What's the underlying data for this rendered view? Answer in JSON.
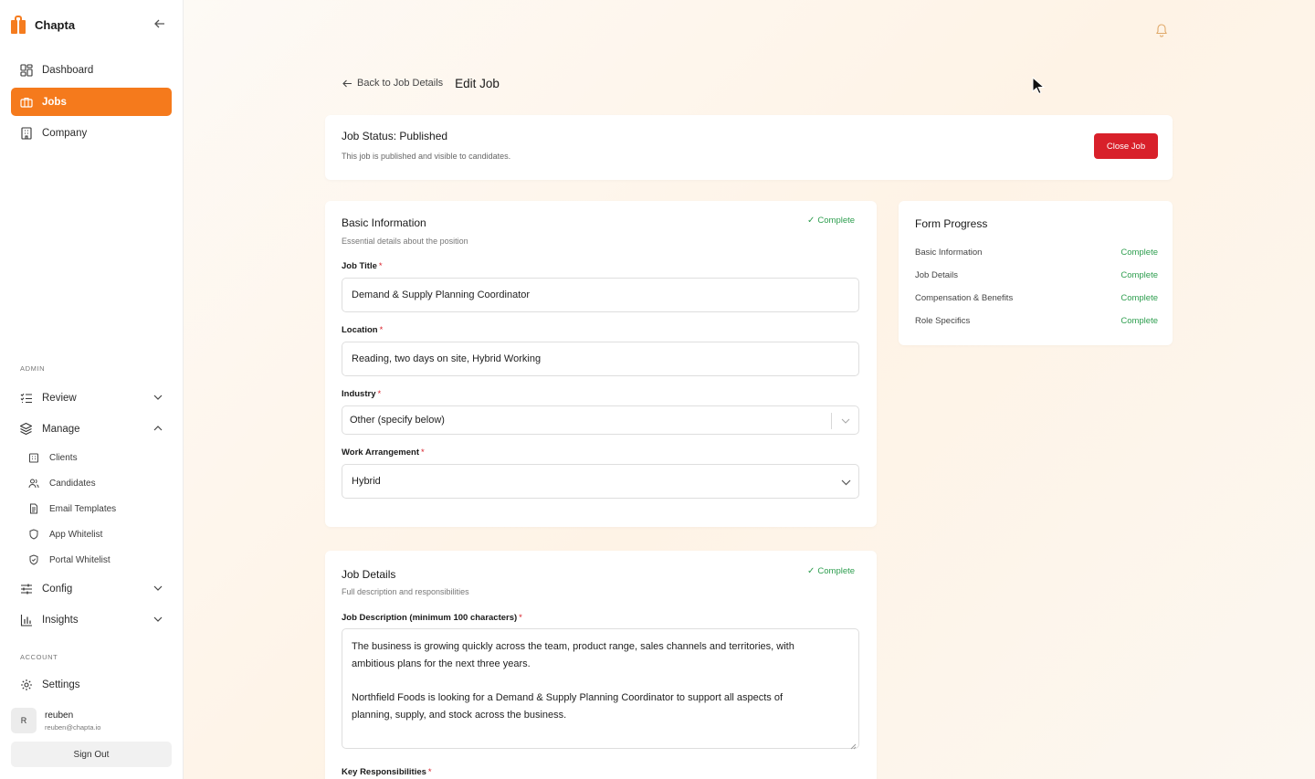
{
  "brand": {
    "name": "Chapta"
  },
  "nav": {
    "primary": [
      {
        "label": "Dashboard",
        "icon": "dashboard-icon"
      },
      {
        "label": "Jobs",
        "icon": "briefcase-icon",
        "active": true
      },
      {
        "label": "Company",
        "icon": "building-icon"
      }
    ],
    "admin_label": "ADMIN",
    "review": {
      "label": "Review"
    },
    "manage": {
      "label": "Manage"
    },
    "manage_items": [
      {
        "label": "Clients",
        "icon": "clients-icon"
      },
      {
        "label": "Candidates",
        "icon": "candidates-icon"
      },
      {
        "label": "Email Templates",
        "icon": "document-icon"
      },
      {
        "label": "App Whitelist",
        "icon": "shield-icon"
      },
      {
        "label": "Portal Whitelist",
        "icon": "shield-check-icon"
      }
    ],
    "config": {
      "label": "Config"
    },
    "insights": {
      "label": "Insights"
    },
    "account_label": "ACCOUNT",
    "settings": {
      "label": "Settings"
    }
  },
  "user": {
    "initial": "R",
    "name": "reuben",
    "email": "reuben@chapta.io"
  },
  "signout_label": "Sign Out",
  "header": {
    "back_label": "Back to Job Details",
    "title": "Edit Job"
  },
  "status": {
    "title": "Job Status: Published",
    "subtitle": "This job is published and visible to candidates.",
    "close_label": "Close Job"
  },
  "basic": {
    "title": "Basic Information",
    "subtitle": "Essential details about the position",
    "badge": "Complete",
    "job_title_label": "Job Title",
    "job_title_value": "Demand & Supply Planning Coordinator",
    "location_label": "Location",
    "location_value": "Reading, two days on site, Hybrid Working",
    "industry_label": "Industry",
    "industry_value": "Other (specify below)",
    "work_label": "Work Arrangement",
    "work_value": "Hybrid",
    "required_mark": "*"
  },
  "details": {
    "title": "Job Details",
    "subtitle": "Full description and responsibilities",
    "badge": "Complete",
    "desc_label": "Job Description (minimum 100 characters)",
    "desc_p1_l1": "The business is growing quickly across the team, product range, sales channels and territories, with",
    "desc_p1_l2": "ambitious plans for the next three years.",
    "desc_p2_l1": "Northfield Foods is looking for a Demand & Supply Planning Coordinator to support all aspects of",
    "desc_p2_l2": "planning, supply, and stock across the business.",
    "resp_label": "Key Responsibilities"
  },
  "progress": {
    "title": "Form Progress",
    "rows": [
      {
        "label": "Basic Information",
        "value": "Complete"
      },
      {
        "label": "Job Details",
        "value": "Complete"
      },
      {
        "label": "Compensation & Benefits",
        "value": "Complete"
      },
      {
        "label": "Role Specifics",
        "value": "Complete"
      }
    ]
  },
  "colors": {
    "accent": "#f57a1c",
    "danger": "#d8202a",
    "success": "#2e9e4f"
  }
}
